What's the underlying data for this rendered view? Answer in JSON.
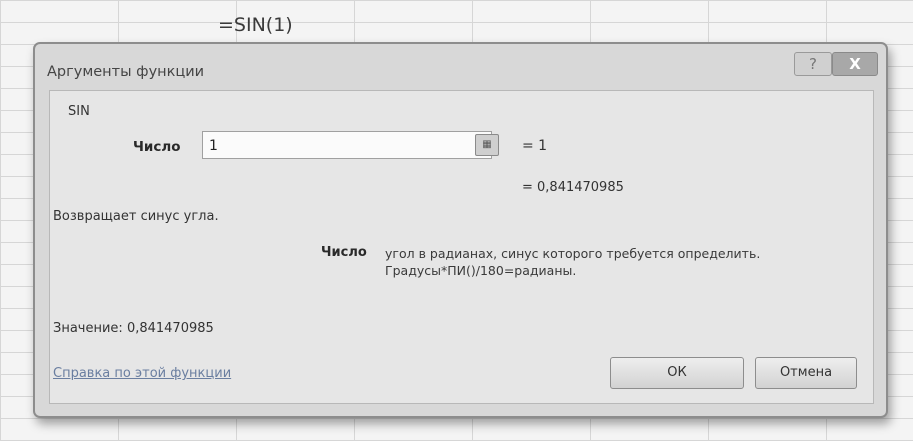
{
  "formula_bar": {
    "text": "=SIN(1)"
  },
  "dialog": {
    "title": "Аргументы функции",
    "help_button": "?",
    "close_button": "X",
    "function_name": "SIN",
    "argument": {
      "label": "Число",
      "value": "1",
      "equals_value": "=  1"
    },
    "result_preview": "=  0,841470985",
    "description": "Возвращает синус угла.",
    "argument_help": {
      "label": "Число",
      "line1": "угол в радианах, синус которого требуется определить.",
      "line2": "Градусы*ПИ()/180=радианы."
    },
    "value_text": "Значение:  0,841470985",
    "help_link": "Справка по этой функции",
    "ok_label": "ОК",
    "cancel_label": "Отмена"
  }
}
